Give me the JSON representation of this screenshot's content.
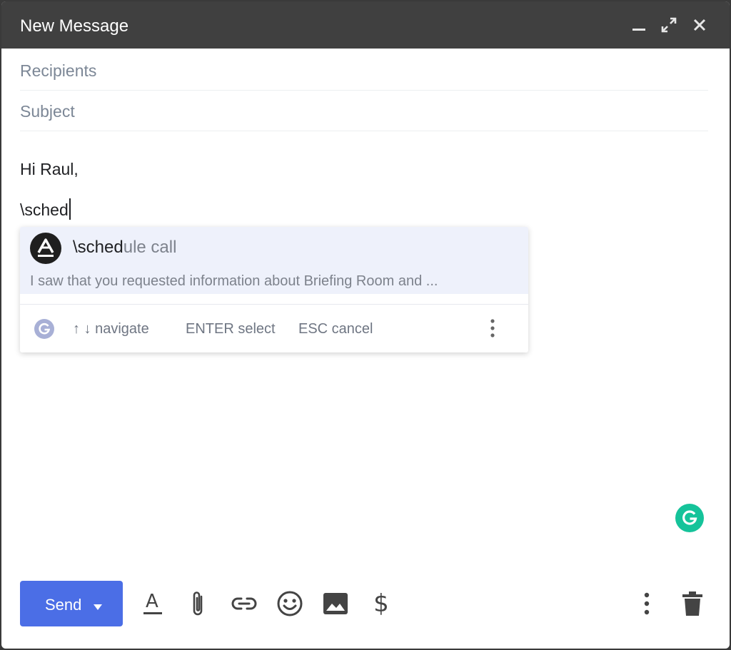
{
  "window": {
    "title": "New Message"
  },
  "fields": {
    "recipients_placeholder": "Recipients",
    "subject_placeholder": "Subject"
  },
  "body": {
    "line1": "Hi Raul,",
    "line2": "\\sched"
  },
  "suggestion": {
    "avatar_letter": "A",
    "title_typed": "\\sched",
    "title_rest": "ule call",
    "preview": "I saw that you requested information about Briefing Room and ..."
  },
  "hints": {
    "g_letter": "G",
    "navigate": "↑ ↓ navigate",
    "select": "ENTER select",
    "cancel": "ESC cancel"
  },
  "toolbar": {
    "send_label": "Send"
  },
  "icons": {
    "minimize": "minimize-icon",
    "expand": "expand-icon",
    "close": "close-icon",
    "formatting": "text-format-icon",
    "attach": "paperclip-icon",
    "link": "link-icon",
    "emoji": "emoji-icon",
    "photo": "image-icon",
    "money": "dollar-icon",
    "more": "more-vert-icon",
    "trash": "trash-icon",
    "grammarly": "grammarly-icon"
  },
  "colors": {
    "send": "#4b6ee6",
    "grammarly": "#15c39a",
    "titlebar": "#404040",
    "suggestion_highlight": "#eef1fb"
  }
}
